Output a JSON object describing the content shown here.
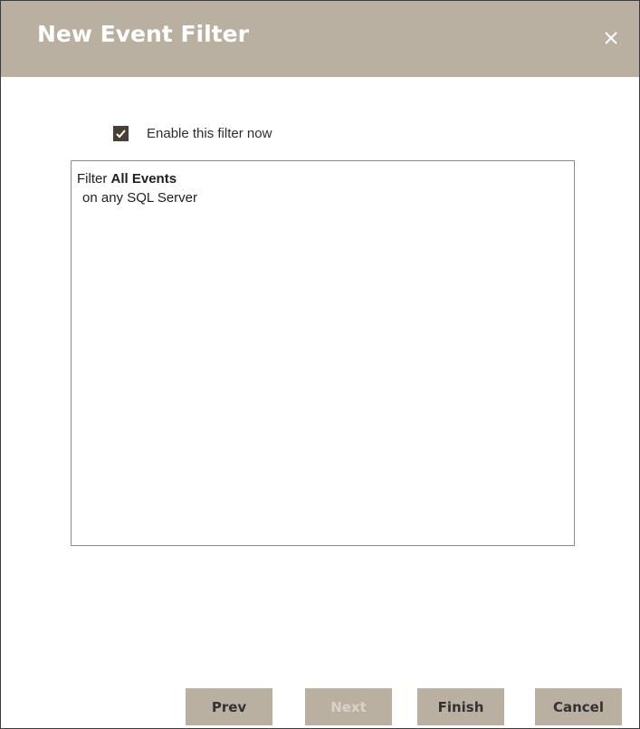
{
  "dialog": {
    "title": "New Event Filter",
    "close_icon": "close-icon",
    "colors": {
      "titlebar": "#b9b0a1",
      "checkbox": "#4a3f35"
    }
  },
  "enable": {
    "checked": true,
    "label": "Enable this filter now"
  },
  "summary": {
    "prefix": "Filter",
    "event_type": "All Events",
    "scope": "on any SQL Server"
  },
  "buttons": {
    "prev": "Prev",
    "next": "Next",
    "finish": "Finish",
    "cancel": "Cancel"
  }
}
